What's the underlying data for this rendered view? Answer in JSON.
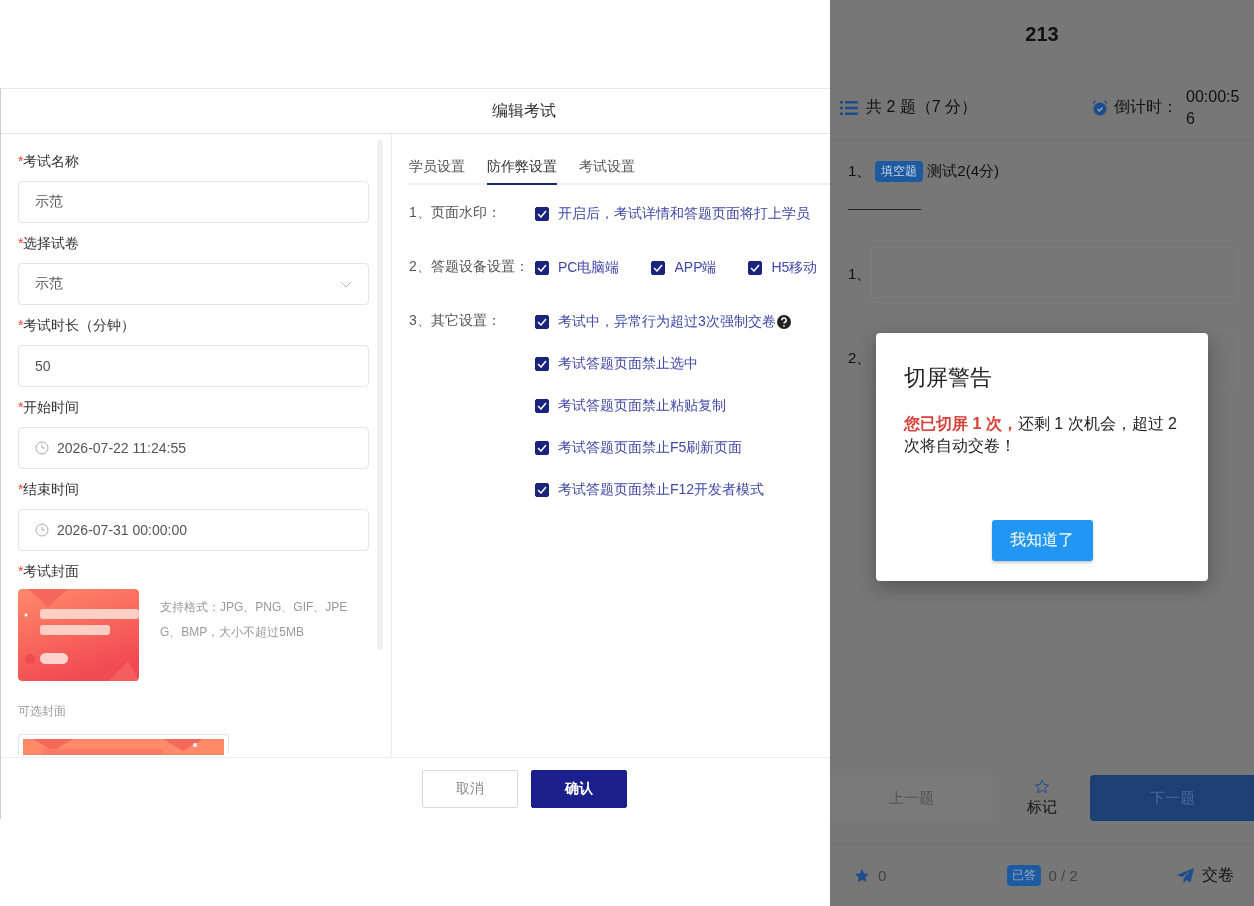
{
  "dialog": {
    "title": "编辑考试",
    "fields": [
      {
        "required_mark": "*",
        "label": "考试名称",
        "kind": "text",
        "value": "示范"
      },
      {
        "required_mark": "*",
        "label": "选择试卷",
        "kind": "select",
        "value": "示范"
      },
      {
        "required_mark": "*",
        "label": "考试时长（分钟）",
        "kind": "text",
        "value": "50"
      },
      {
        "required_mark": "*",
        "label": "开始时间",
        "kind": "date",
        "value": "2026-07-22 11:24:55"
      },
      {
        "required_mark": "*",
        "label": "结束时间",
        "kind": "date",
        "value": "2026-07-31 00:00:00"
      }
    ],
    "cover": {
      "required_mark": "*",
      "label": "考试封面",
      "hint": "支持格式：JPG、PNG、GIF、JPEG、BMP，大小不超过5MB",
      "optional_label": "可选封面"
    },
    "tabs": [
      {
        "label": "学员设置",
        "selected": false
      },
      {
        "label": "防作弊设置",
        "selected": true
      },
      {
        "label": "考试设置",
        "selected": false
      }
    ],
    "settings": [
      {
        "label": "1、页面水印：",
        "kind": "stack",
        "options": [
          {
            "label": "开启后，考试详情和答题页面将打上学员",
            "checked": true
          }
        ]
      },
      {
        "label": "2、答题设备设置：",
        "kind": "inline",
        "options": [
          {
            "label": "PC电脑端",
            "checked": true
          },
          {
            "label": "APP端",
            "checked": true
          },
          {
            "label": "H5移动",
            "checked": true
          }
        ]
      },
      {
        "label": "3、其它设置：",
        "kind": "stack",
        "options": [
          {
            "label": "考试中，异常行为超过3次强制交卷",
            "checked": true,
            "help": true
          },
          {
            "label": "考试答题页面禁止选中",
            "checked": true
          },
          {
            "label": "考试答题页面禁止粘贴复制",
            "checked": true
          },
          {
            "label": "考试答题页面禁止F5刷新页面",
            "checked": true
          },
          {
            "label": "考试答题页面禁止F12开发者模式",
            "checked": true
          }
        ]
      }
    ],
    "buttons": [
      {
        "label": "取消",
        "kind": "secondary"
      },
      {
        "label": "确认",
        "kind": "primary"
      }
    ]
  },
  "mobile": {
    "title": "213",
    "summary": "共 2 题（7 分）",
    "countdown_label": "倒计时：",
    "countdown": "00:00:56",
    "question": {
      "number": "1、",
      "type": "填空题",
      "text": "测试2(4分)"
    },
    "answers": [
      {
        "number": "1、"
      },
      {
        "number": "2、"
      }
    ],
    "nav": {
      "prev": "上一题",
      "mark": "标记",
      "next": "下一题"
    },
    "footer": {
      "starred": "0",
      "answered_badge": "已答",
      "answered": "0 / 2",
      "submit": "交卷"
    },
    "modal": {
      "title": "切屏警告",
      "message": "**您已切屏 1 次，**还剩 1 次机会，超过 2 次将自动交卷！",
      "button": "我知道了"
    }
  }
}
